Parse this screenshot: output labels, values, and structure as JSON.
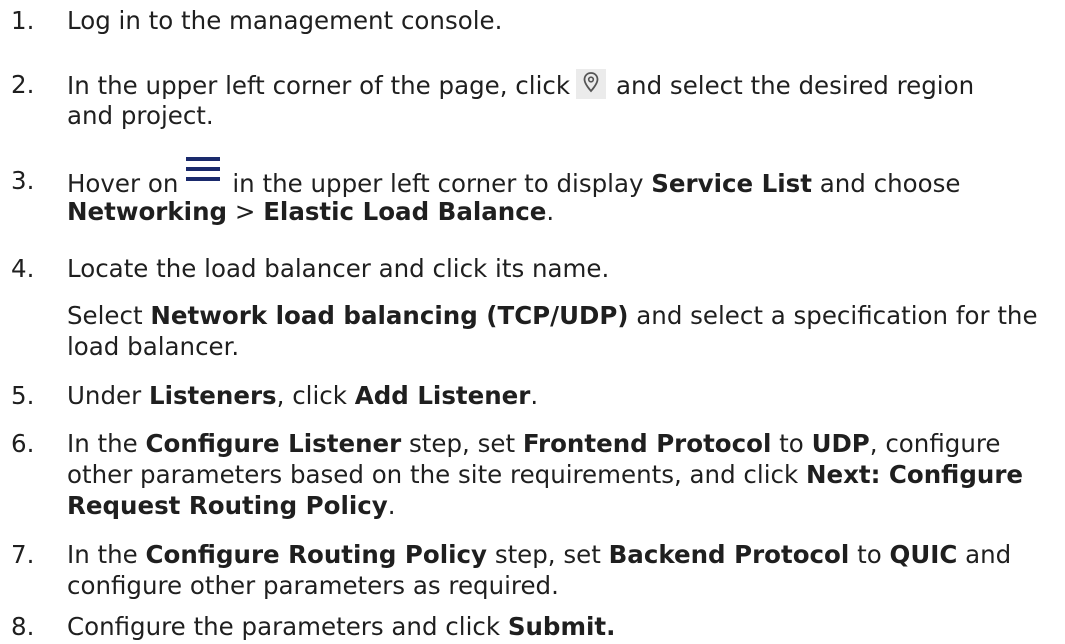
{
  "steps": [
    {
      "num": "1.",
      "t1": "Log in to the management console."
    },
    {
      "num": "2.",
      "t1": "In the upper left corner of the page, click",
      "t2": "and select the desired region",
      "t3": "and project."
    },
    {
      "num": "3.",
      "t1": "Hover on",
      "t2": "in the upper left corner to display",
      "b1": "Service List",
      "t3": "and choose",
      "b2": "Networking",
      "t4": ">",
      "b3": "Elastic Load Balance",
      "t5": "."
    },
    {
      "num": "4.",
      "t1": "Locate the load balancer and click its name.",
      "p_t1": "Select",
      "p_b1": "Network load balancing (TCP/UDP)",
      "p_t2": "and select a specification for the",
      "p_t3": "load balancer."
    },
    {
      "num": "5.",
      "t1": "Under",
      "b1": "Listeners",
      "t2": ", click",
      "b2": "Add Listener",
      "t3": "."
    },
    {
      "num": "6.",
      "t1": "In the",
      "b1": "Configure Listener",
      "t2": "step, set",
      "b2": "Frontend Protocol",
      "t3": "to",
      "b3": "UDP",
      "t4": ", configure",
      "t5": "other parameters based on the site requirements, and click",
      "b4": "Next: Configure",
      "b5": "Request Routing Policy",
      "t6": "."
    },
    {
      "num": "7.",
      "t1": "In the",
      "b1": "Configure Routing Policy",
      "t2": "step, set",
      "b2": "Backend Protocol",
      "t3": "to",
      "b3": "QUIC",
      "t4": "and",
      "t5": "configure other parameters as required."
    },
    {
      "num": "8.",
      "t1": "Configure the parameters and click",
      "b1": "Submit."
    }
  ],
  "icons": {
    "location": "location-pin-icon",
    "menu": "hamburger-menu-icon"
  },
  "colors": {
    "text": "#1f1f1f",
    "menu_icon": "#1a2a6c",
    "icon_bg": "#ebebeb"
  }
}
